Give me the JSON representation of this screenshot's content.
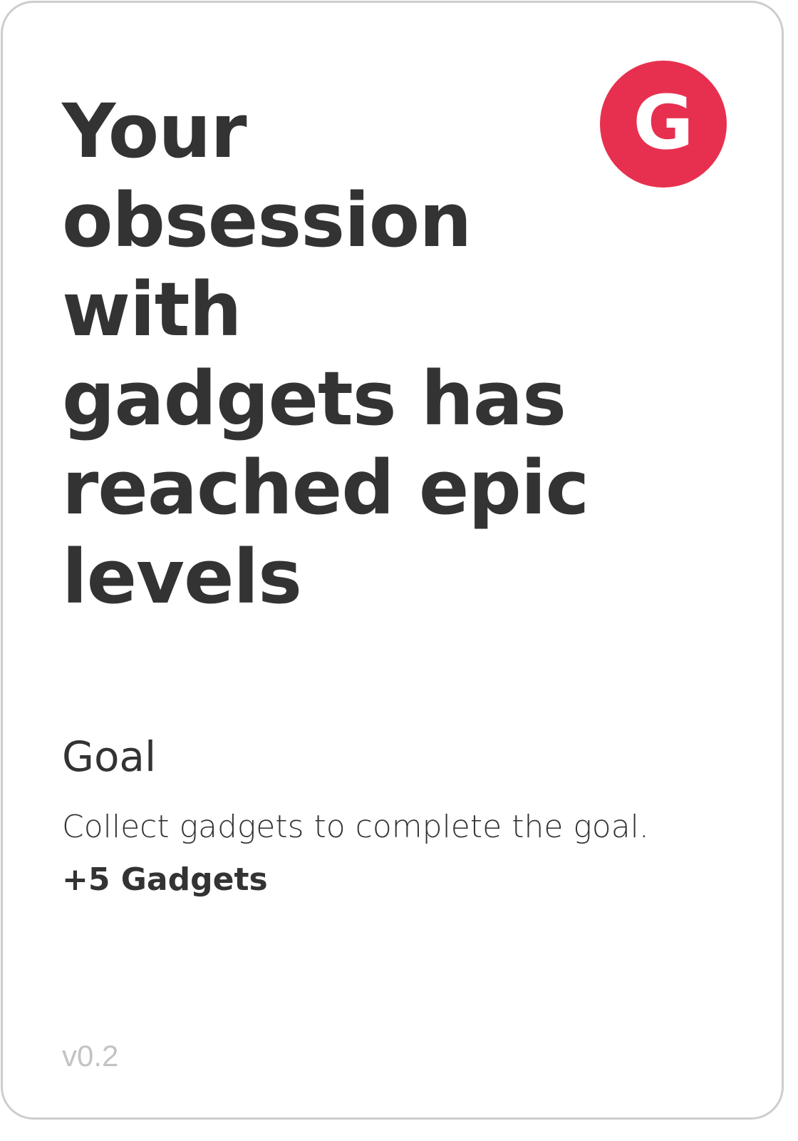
{
  "card": {
    "headline": "Your obsession with gadgets has reached epic levels",
    "badge": {
      "letter": "G",
      "color": "#e7304f"
    },
    "goal": {
      "label": "Goal",
      "description": "Collect gadgets to complete the goal.",
      "reward": "+5 Gadgets"
    },
    "version": "v0.2"
  }
}
